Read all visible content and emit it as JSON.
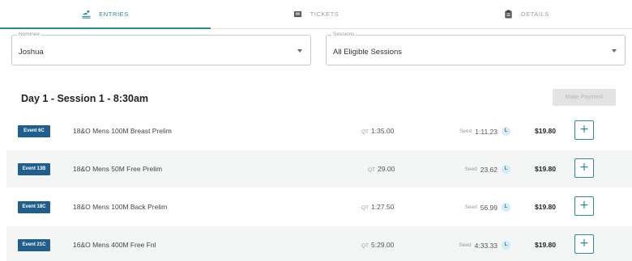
{
  "tabs": [
    {
      "label": "ENTRIES",
      "icon": "swimmer-icon",
      "active": true
    },
    {
      "label": "TICKETS",
      "icon": "ticket-icon",
      "active": false
    },
    {
      "label": "DETAILS",
      "icon": "clipboard-icon",
      "active": false
    }
  ],
  "filters": {
    "nominee": {
      "label": "Nominee",
      "value": "Joshua"
    },
    "sessions": {
      "label": "Sessions",
      "value": "All Eligible Sessions"
    }
  },
  "session": {
    "title": "Day 1 - Session 1 - 8:30am",
    "pay_label": "Make Payment"
  },
  "qt_label": "QT",
  "seed_label": "Seed",
  "l_badge": "L",
  "events": [
    {
      "badge": "Event 6C",
      "name": "18&O Mens 100M Breast Prelim",
      "qt": "1:35.00",
      "seed": "1:11.23",
      "price": "$19.80"
    },
    {
      "badge": "Event 13B",
      "name": "18&O Mens 50M Free Prelim",
      "qt": "29.00",
      "seed": "23.62",
      "price": "$19.80"
    },
    {
      "badge": "Event 18C",
      "name": "18&O Mens 100M Back Prelim",
      "qt": "1:27.50",
      "seed": "56.99",
      "price": "$19.80"
    },
    {
      "badge": "Event 21C",
      "name": "16&O Mens 400M Free Fnl",
      "qt": "5:29.00",
      "seed": "4:33.33",
      "price": "$19.80"
    }
  ],
  "add_label": "+",
  "colors": {
    "accent": "#2a8a96",
    "badge": "#1f5e8d"
  }
}
